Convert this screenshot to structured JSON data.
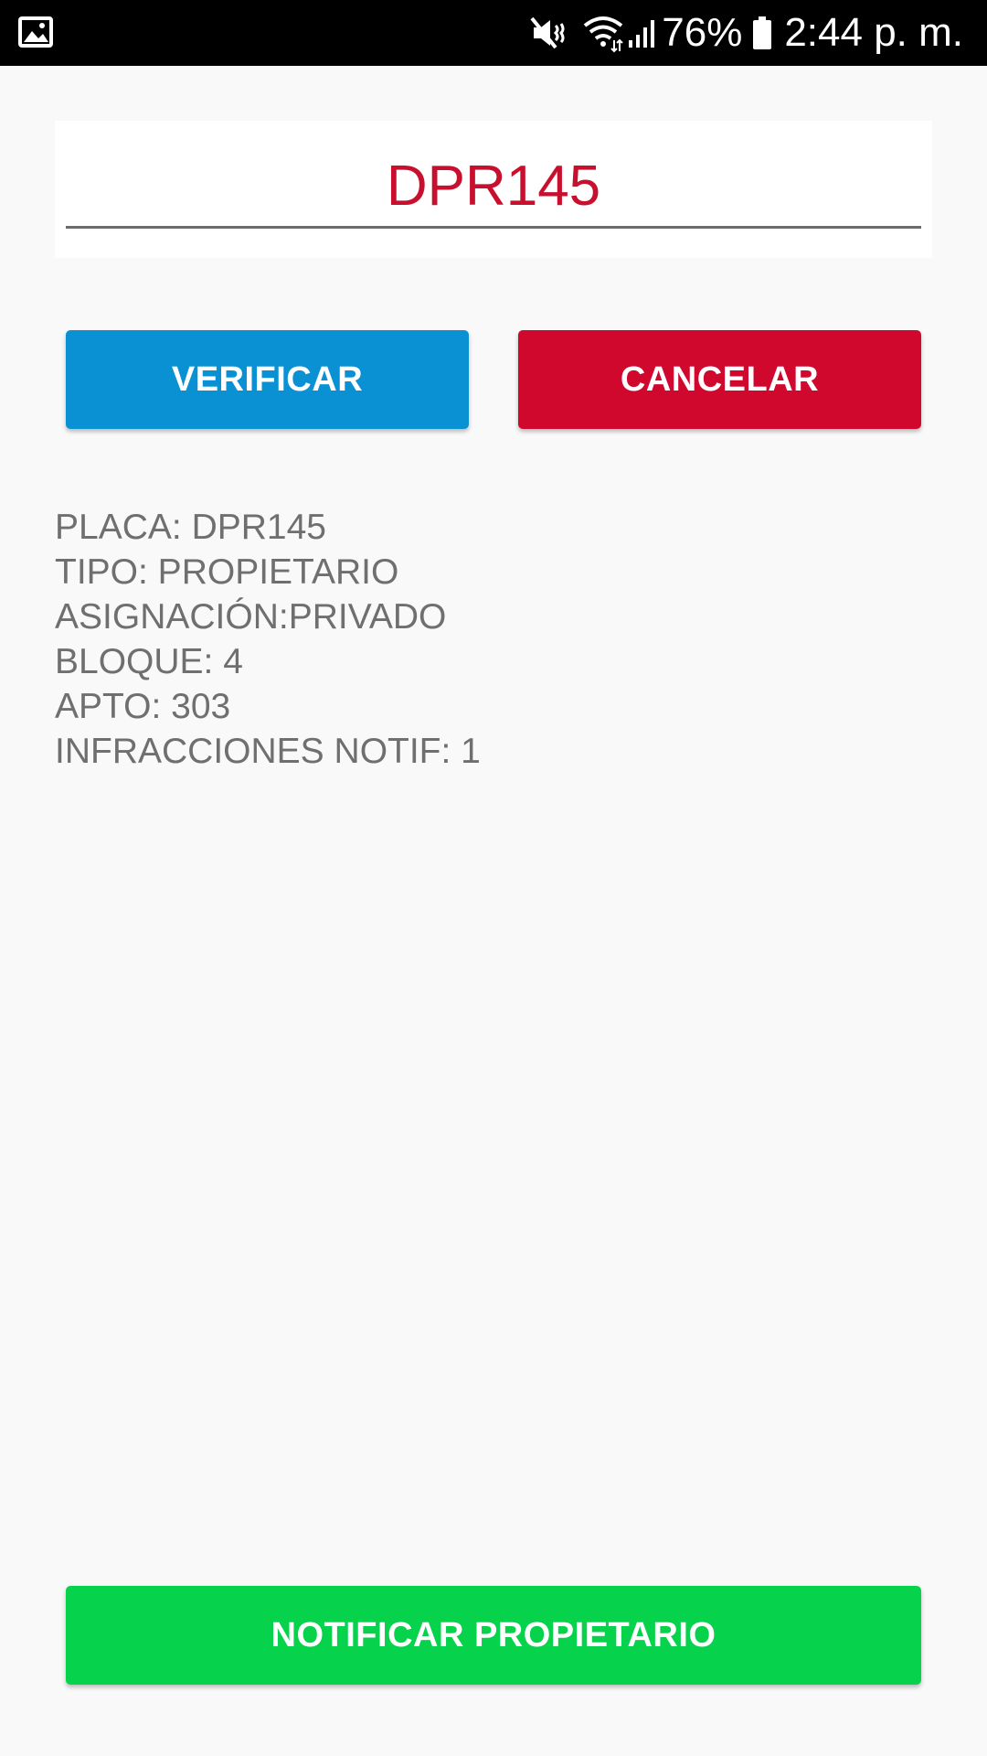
{
  "status_bar": {
    "battery": "76%",
    "time": "2:44 p. m.",
    "icons": [
      "gallery-icon",
      "mute-icon",
      "wifi-icon",
      "signal-icon",
      "battery-icon"
    ]
  },
  "plate_field": {
    "value": "DPR145",
    "color": "#c8102e"
  },
  "buttons": {
    "verify": "VERIFICAR",
    "cancel": "CANCELAR",
    "notify": "NOTIFICAR PROPIETARIO"
  },
  "colors": {
    "verify": "#0a91d3",
    "cancel": "#d0082e",
    "notify": "#07d24c"
  },
  "info": {
    "lines": [
      "PLACA: DPR145",
      "TIPO: PROPIETARIO",
      "ASIGNACIÓN:PRIVADO",
      "BLOQUE: 4",
      "APTO: 303",
      "INFRACCIONES NOTIF: 1"
    ]
  }
}
